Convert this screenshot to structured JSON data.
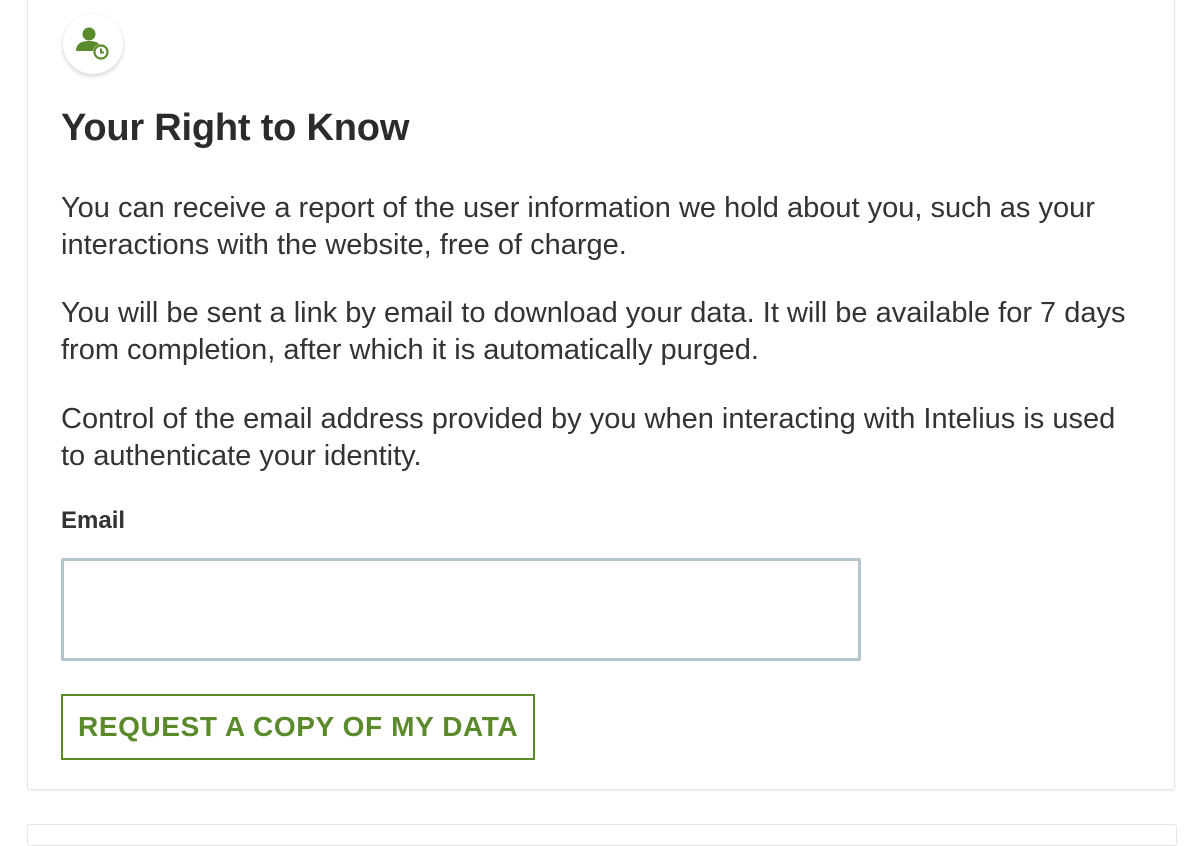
{
  "section": {
    "icon": "user-history-icon",
    "accent_color": "#5b8a2d",
    "title": "Your Right to Know",
    "paragraphs": [
      "You can receive a report of the user information we hold about you, such as your interactions with the website, free of charge.",
      "You will be sent a link by email to download your data. It will be available for 7 days from completion, after which it is automatically purged.",
      "Control of the email address provided by you when interacting with Intelius is used to authenticate your identity."
    ]
  },
  "form": {
    "email_label": "Email",
    "email_value": "",
    "email_placeholder": "",
    "submit_label": "REQUEST A COPY OF MY DATA"
  }
}
